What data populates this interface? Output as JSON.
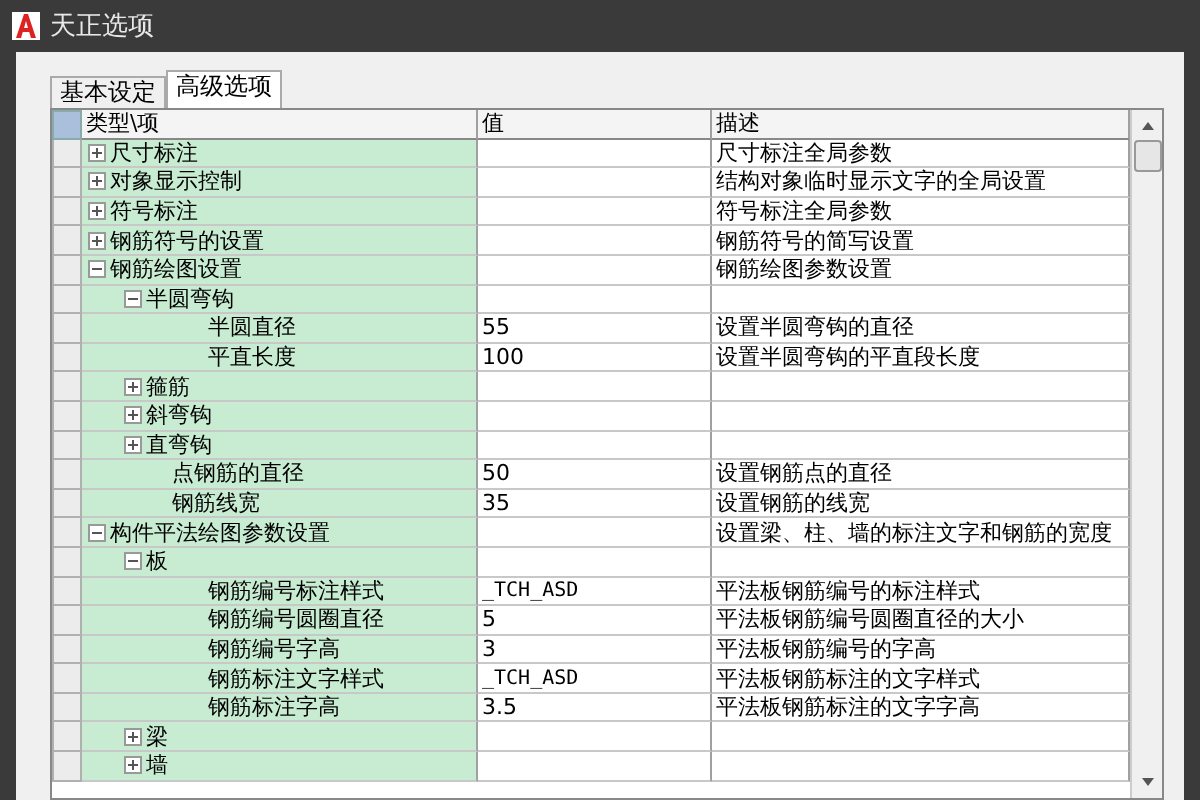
{
  "window": {
    "title": "天正选项"
  },
  "tabs": [
    {
      "label": "基本设定",
      "selected": false
    },
    {
      "label": "高级选项",
      "selected": true
    }
  ],
  "table": {
    "columns": [
      "类型\\项",
      "值",
      "描述"
    ],
    "items": [
      {
        "name": "尺寸标注",
        "expanded": false,
        "description": "尺寸标注全局参数"
      },
      {
        "name": "对象显示控制",
        "expanded": false,
        "description": "结构对象临时显示文字的全局设置"
      },
      {
        "name": "符号标注",
        "expanded": false,
        "description": "符号标注全局参数"
      },
      {
        "name": "钢筋符号的设置",
        "expanded": false,
        "description": "钢筋符号的简写设置"
      },
      {
        "name": "钢筋绘图设置",
        "expanded": true,
        "description": "钢筋绘图参数设置",
        "children": [
          {
            "name": "半圆弯钩",
            "expanded": true,
            "children": [
              {
                "name": "半圆直径",
                "value": "55",
                "description": "设置半圆弯钩的直径"
              },
              {
                "name": "平直长度",
                "value": "100",
                "description": "设置半圆弯钩的平直段长度"
              }
            ]
          },
          {
            "name": "箍筋",
            "expanded": false
          },
          {
            "name": "斜弯钩",
            "expanded": false
          },
          {
            "name": "直弯钩",
            "expanded": false
          },
          {
            "name": "点钢筋的直径",
            "value": "50",
            "description": "设置钢筋点的直径"
          },
          {
            "name": "钢筋线宽",
            "value": "35",
            "description": "设置钢筋的线宽"
          }
        ]
      },
      {
        "name": "构件平法绘图参数设置",
        "expanded": true,
        "description": "设置梁、柱、墙的标注文字和钢筋的宽度",
        "children": [
          {
            "name": "板",
            "expanded": true,
            "children": [
              {
                "name": "钢筋编号标注样式",
                "value": "_TCH_ASD",
                "description": "平法板钢筋编号的标注样式"
              },
              {
                "name": "钢筋编号圆圈直径",
                "value": "5",
                "description": "平法板钢筋编号圆圈直径的大小"
              },
              {
                "name": "钢筋编号字高",
                "value": "3",
                "description": "平法板钢筋编号的字高"
              },
              {
                "name": "钢筋标注文字样式",
                "value": "_TCH_ASD",
                "description": "平法板钢筋标注的文字样式"
              },
              {
                "name": "钢筋标注字高",
                "value": "3.5",
                "description": "平法板钢筋标注的文字字高"
              }
            ]
          },
          {
            "name": "梁",
            "expanded": false
          },
          {
            "name": "墙",
            "expanded": false
          }
        ]
      }
    ]
  }
}
